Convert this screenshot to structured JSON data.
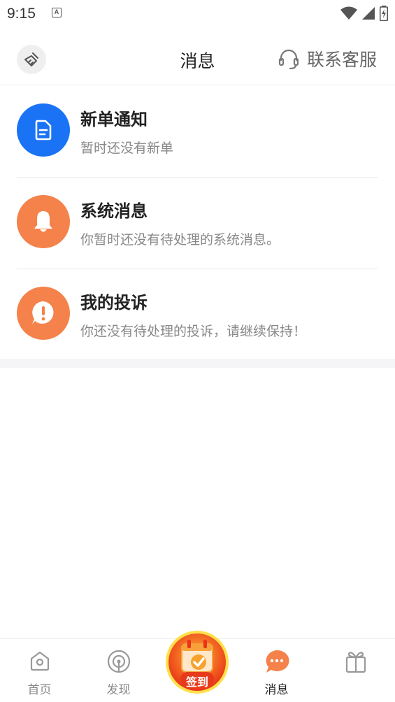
{
  "status": {
    "time": "9:15",
    "notif_letter": "A"
  },
  "header": {
    "title": "消息",
    "service_label": "联系客服"
  },
  "messages": [
    {
      "title": "新单通知",
      "subtitle": "暂时还没有新单",
      "icon": "document-icon",
      "color": "#1a73f5"
    },
    {
      "title": "系统消息",
      "subtitle": "你暂时还没有待处理的系统消息。",
      "icon": "bell-icon",
      "color": "#f4824a"
    },
    {
      "title": "我的投诉",
      "subtitle": "你还没有待处理的投诉，请继续保持！",
      "icon": "exclamation-bubble-icon",
      "color": "#f4824a"
    }
  ],
  "tabs": [
    {
      "label": "首页",
      "icon": "home-icon"
    },
    {
      "label": "发现",
      "icon": "discover-icon"
    },
    {
      "label": "签到",
      "icon": "calendar-check-icon"
    },
    {
      "label": "消息",
      "icon": "chat-bubble-icon",
      "active": true
    },
    {
      "label": "",
      "icon": "gift-icon"
    }
  ],
  "colors": {
    "accent_orange": "#f4824a",
    "accent_blue": "#1a73f5"
  }
}
